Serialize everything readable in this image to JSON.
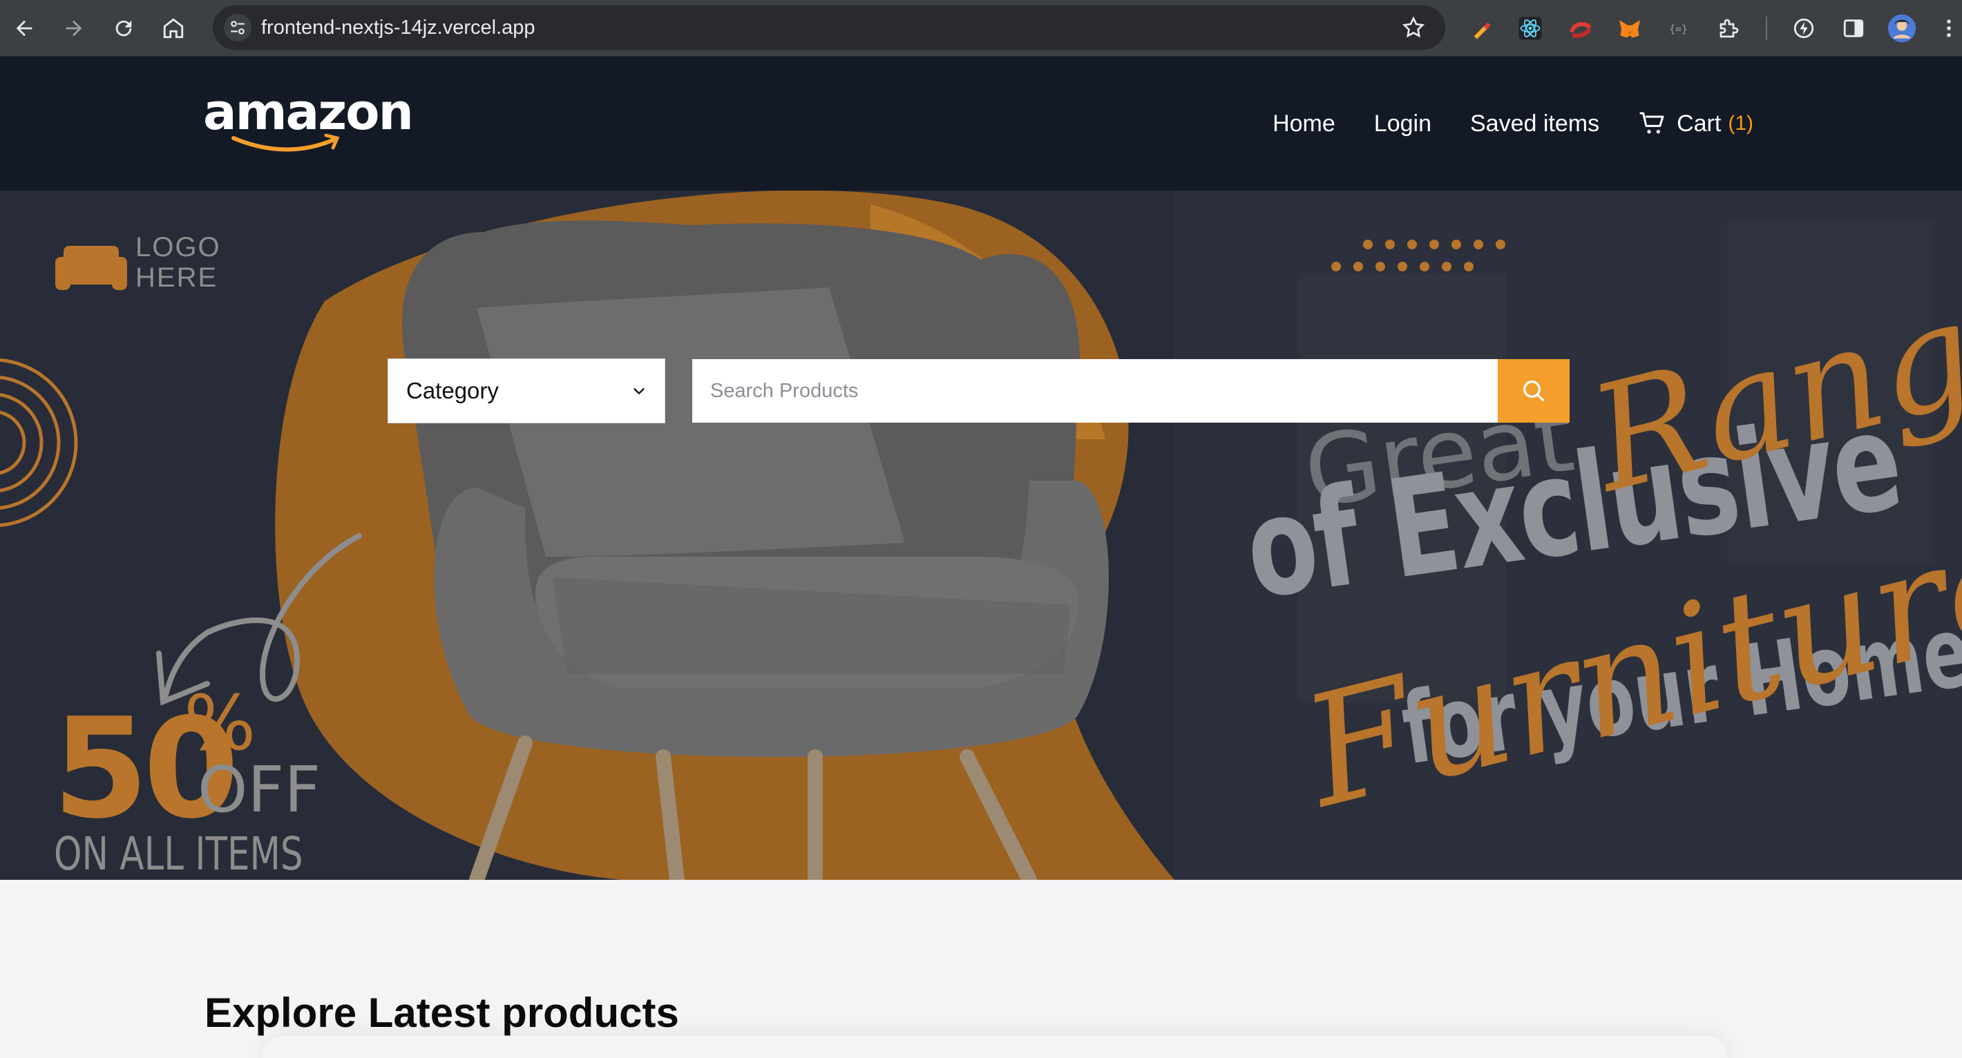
{
  "browser": {
    "url": "frontend-nextjs-14jz.vercel.app"
  },
  "header": {
    "logo_text": "amazon",
    "nav": {
      "home": "Home",
      "login": "Login",
      "saved": "Saved items",
      "cart": "Cart",
      "cart_count": "(1)"
    }
  },
  "hero": {
    "logo_placeholder_line1": "LOGO",
    "logo_placeholder_line2": "HERE",
    "promo_number": "50",
    "promo_percent": "%",
    "promo_off": "OFF",
    "promo_subtitle": "ON ALL ITEMS",
    "tagline_great": "Great",
    "tagline_range": "Range",
    "tagline_exclusive": "of Exclusive",
    "tagline_furniture": "Furniture",
    "tagline_home": "for your Home"
  },
  "search": {
    "category_label": "Category",
    "placeholder": "Search Products"
  },
  "products": {
    "section_title": "Explore Latest products"
  },
  "colors": {
    "header_bg": "#131a26",
    "accent": "#f59e2b",
    "page_bg": "#f3f4f6"
  }
}
